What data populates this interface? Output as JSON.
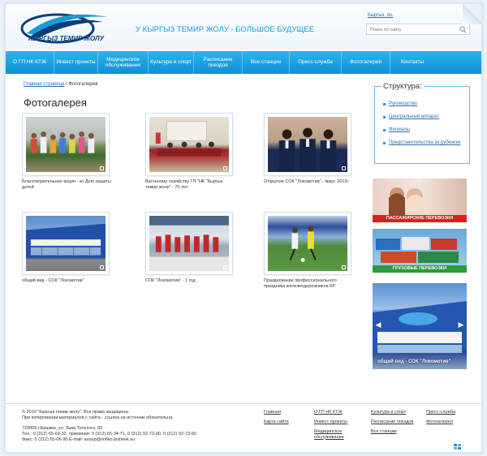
{
  "header": {
    "logo_text": "КЫРГЫЗ ТЕМИР ЖОЛУ",
    "slogan": "У КЫРГЫЗ ТЕМИР ЖОЛУ - БОЛЬШОЕ БУДУЩЕЕ",
    "lang_link": "Кыргыз. яз.",
    "search_placeholder": "Поиск по сайту"
  },
  "nav": [
    {
      "label": "О ГП НК КТЖ"
    },
    {
      "label": "Инвест проекты"
    },
    {
      "label": "Медицинское обслуживание"
    },
    {
      "label": "Культура и спорт"
    },
    {
      "label": "Расписание поездов"
    },
    {
      "label": "Все станции"
    },
    {
      "label": "Пресс-служба"
    },
    {
      "label": "Фотогалерея"
    },
    {
      "label": "Контакты"
    }
  ],
  "breadcrumb": {
    "home": "Главная страница",
    "separator": "/",
    "current": "Фотогалерея"
  },
  "page_title": "Фотогалерея",
  "gallery": [
    {
      "caption": "Благотворительная акция - ко Дню защиты детей"
    },
    {
      "caption": "Вагонному хозяйству ГП \"НК \"Кыргыз темир жолу\" - 70 лет"
    },
    {
      "caption": "Открытие СОК \"Локомотив\" - март, 2012г"
    },
    {
      "caption": "общий вид - СОК \"Локомотив\""
    },
    {
      "caption": "СОК \"Локомотив\" - 1 год"
    },
    {
      "caption": "Празднование профессионального праздника железнодорожников КР"
    }
  ],
  "sidebar": {
    "structure_title": "Структура:",
    "structure_items": [
      {
        "label": "Руководство"
      },
      {
        "label": "Центральный аппарат"
      },
      {
        "label": "Филиалы"
      },
      {
        "label": "Представительства за рубежом"
      }
    ],
    "banners": [
      {
        "label": "ПАССАЖИРСКИЕ ПЕРЕВОЗКИ",
        "color": "#d6231e"
      },
      {
        "label": "ГРУЗОВЫЕ ПЕРЕВОЗКИ",
        "color": "#2b9a3a"
      }
    ],
    "slider_caption": "общий вид - СОК \"Локомотив\""
  },
  "footer": {
    "copyright": "© 2010 \"Кыргыз темир жолу\". Все права защищены.",
    "copy_note": "При копировании материалов с сайта - ссылка на источник обязательна.",
    "address": "720009 г.Бишкек, ул. Льва Толстого, 83",
    "phones": "Тел.: 0 (312) 65-69-32, приемная: 0 (312) 65-34-71, 0 (312) 92-73-00, 0 (312) 92-73-50",
    "fax": "Факс: 0 (312) 65-06-90 E-mail: asoup@imfiko.bishkek.su",
    "links": [
      {
        "label": "Главная"
      },
      {
        "label": "Карта сайта"
      },
      {
        "label": "О ГП НК КТЖ"
      },
      {
        "label": "Инвест проекты"
      },
      {
        "label": "Медицинское обслуживание"
      },
      {
        "label": "Культура и спорт"
      },
      {
        "label": "Расписание поездов"
      },
      {
        "label": "Все станции"
      },
      {
        "label": "Пресс-служба"
      },
      {
        "label": "Фотогалерея"
      }
    ]
  },
  "colors": {
    "accent": "#1a9bd8",
    "nav": "#0e8fd4",
    "link": "#2b6fb0"
  }
}
